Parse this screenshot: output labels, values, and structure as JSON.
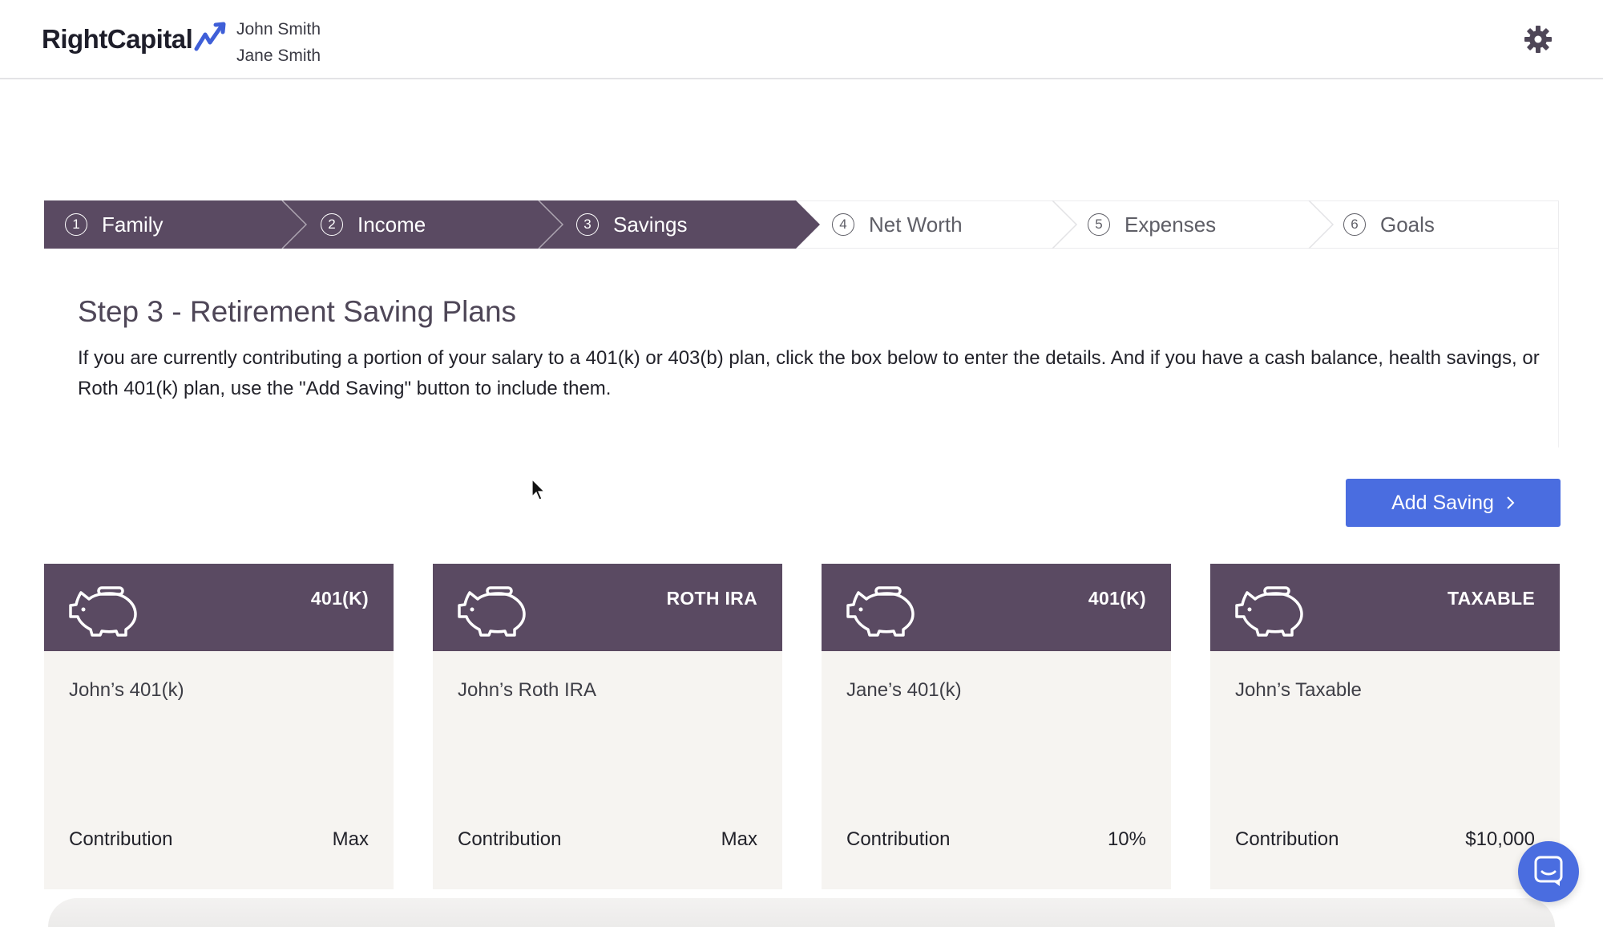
{
  "header": {
    "brand": "RightCapital",
    "clients": [
      "John Smith",
      "Jane Smith"
    ]
  },
  "steps": [
    {
      "num": "1",
      "label": "Family",
      "state": "done"
    },
    {
      "num": "2",
      "label": "Income",
      "state": "done"
    },
    {
      "num": "3",
      "label": "Savings",
      "state": "done"
    },
    {
      "num": "4",
      "label": "Net Worth",
      "state": "todo"
    },
    {
      "num": "5",
      "label": "Expenses",
      "state": "todo"
    },
    {
      "num": "6",
      "label": "Goals",
      "state": "todo"
    }
  ],
  "content": {
    "title": "Step 3 - Retirement Saving Plans",
    "description": "If you are currently contributing a portion of your salary to a 401(k) or 403(b) plan, click the box below to enter the details. And if you have a cash balance, health savings, or Roth 401(k) plan, use the \"Add Saving\" button to include them."
  },
  "add_button": {
    "label": "Add Saving"
  },
  "cards": [
    {
      "type": "401(K)",
      "name": "John’s 401(k)",
      "contribution_label": "Contribution",
      "contribution_value": "Max"
    },
    {
      "type": "ROTH IRA",
      "name": "John’s Roth IRA",
      "contribution_label": "Contribution",
      "contribution_value": "Max"
    },
    {
      "type": "401(K)",
      "name": "Jane’s 401(k)",
      "contribution_label": "Contribution",
      "contribution_value": "10%"
    },
    {
      "type": "TAXABLE",
      "name": "John’s Taxable",
      "contribution_label": "Contribution",
      "contribution_value": "$10,000"
    }
  ],
  "colors": {
    "brand_purple": "#5a4a62",
    "accent_blue": "#4a6de0",
    "card_bg": "#f6f4f1"
  },
  "icons": [
    "logo-arrow-icon",
    "gear-icon",
    "piggy-bank-icon",
    "chevron-right-icon",
    "chat-icon",
    "cursor-icon"
  ]
}
